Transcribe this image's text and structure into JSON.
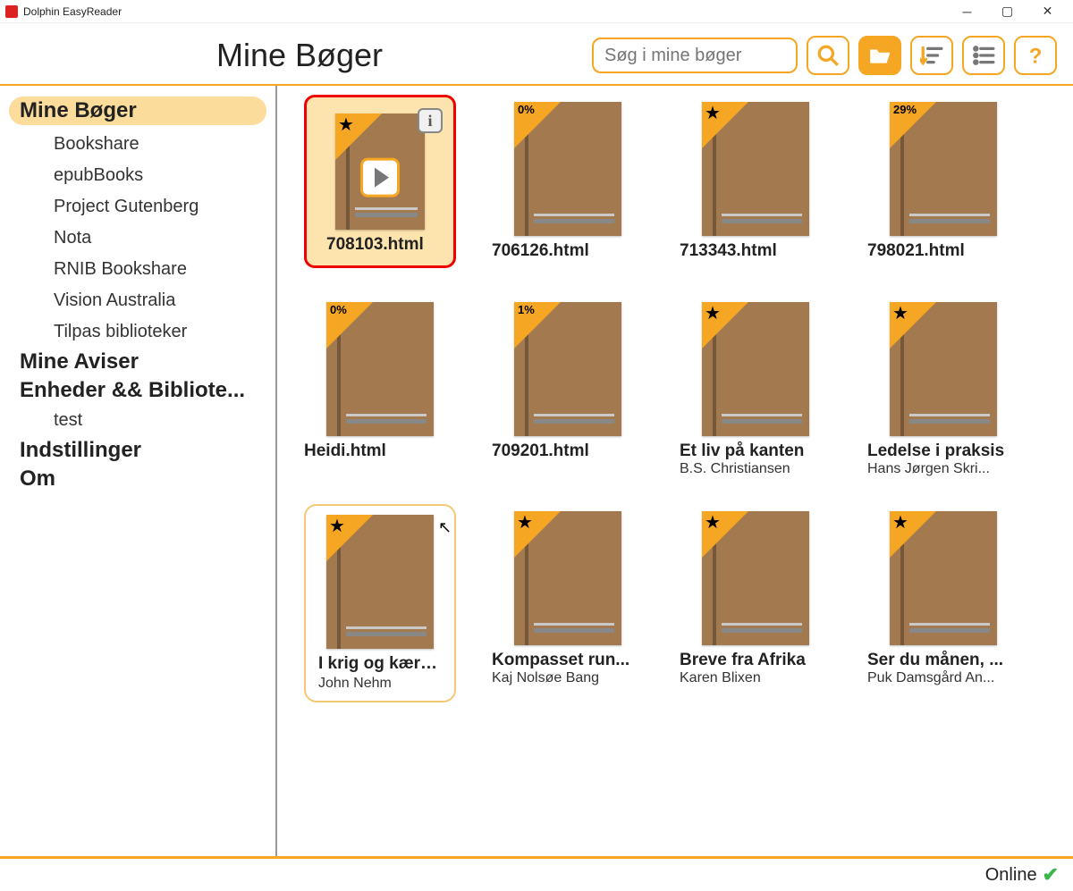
{
  "window": {
    "title": "Dolphin EasyReader"
  },
  "header": {
    "page_title": "Mine Bøger",
    "search_placeholder": "Søg i mine bøger"
  },
  "toolbar_icons": {
    "search": "search-icon",
    "open_folder": "folder-open-icon",
    "sort": "sort-icon",
    "list_view": "list-icon",
    "help": "help-icon"
  },
  "sidebar": {
    "items": [
      {
        "label": "Mine Bøger",
        "type": "top",
        "active": true
      },
      {
        "label": "Bookshare",
        "type": "sub"
      },
      {
        "label": "epubBooks",
        "type": "sub"
      },
      {
        "label": "Project Gutenberg",
        "type": "sub"
      },
      {
        "label": "Nota",
        "type": "sub"
      },
      {
        "label": "RNIB Bookshare",
        "type": "sub"
      },
      {
        "label": "Vision Australia",
        "type": "sub"
      },
      {
        "label": "Tilpas biblioteker",
        "type": "sub"
      },
      {
        "label": "Mine Aviser",
        "type": "top"
      },
      {
        "label": "Enheder && Bibliote...",
        "type": "top"
      },
      {
        "label": "test",
        "type": "sub"
      },
      {
        "label": "Indstillinger",
        "type": "top"
      },
      {
        "label": "Om",
        "type": "top"
      }
    ]
  },
  "books": [
    {
      "title": "708103.html",
      "author": "",
      "badge": "star",
      "selected": true
    },
    {
      "title": "706126.html",
      "author": "",
      "badge": "0%"
    },
    {
      "title": "713343.html",
      "author": "",
      "badge": "star"
    },
    {
      "title": "798021.html",
      "author": "",
      "badge": "29%"
    },
    {
      "title": "Heidi.html",
      "author": "",
      "badge": "0%"
    },
    {
      "title": "709201.html",
      "author": "",
      "badge": "1%"
    },
    {
      "title": "Et liv på kanten",
      "author": "B.S. Christiansen",
      "badge": "star"
    },
    {
      "title": "Ledelse i praksis",
      "author": "Hans Jørgen Skri...",
      "badge": "star"
    },
    {
      "title": "I krig og kærlig...",
      "author": "John Nehm",
      "badge": "star",
      "hover": true
    },
    {
      "title": "Kompasset run...",
      "author": "Kaj Nolsøe Bang",
      "badge": "star"
    },
    {
      "title": "Breve fra Afrika",
      "author": "Karen Blixen",
      "badge": "star"
    },
    {
      "title": "Ser du månen, ...",
      "author": "Puk Damsgård An...",
      "badge": "star"
    }
  ],
  "status": {
    "online_label": "Online"
  }
}
